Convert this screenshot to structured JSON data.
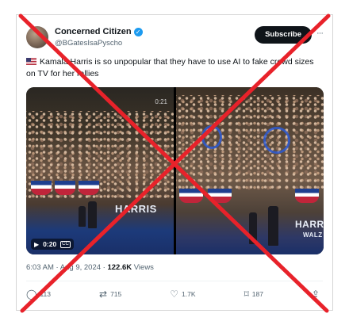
{
  "account": {
    "name": "Concerned Citizen",
    "handle": "@BGatesIsaPyscho",
    "subscribe_label": "Subscribe",
    "more_label": "···"
  },
  "tweet": {
    "text": "Kamala Harris is so unpopular that they have to use AI to fake crowd sizes on TV for her rallies"
  },
  "media": {
    "left": {
      "video_time": "0:20",
      "corner_time": "0:21",
      "cc_label": "CC",
      "sign_text": "HARRIS"
    },
    "right": {
      "sign_text": "HARRIS",
      "sign_sub": "WALZ"
    }
  },
  "meta": {
    "time": "6:03 AM",
    "date": "Aug 9, 2024",
    "views_count": "122.6K",
    "views_label": "Views"
  },
  "actions": {
    "replies": "113",
    "reposts": "715",
    "likes": "1.7K",
    "bookmarks": "187"
  },
  "colors": {
    "verified": "#1d9bf0",
    "subscribe_bg": "#0f1419",
    "x_overlay": "#e8222a"
  },
  "icons": [
    "verified-badge-icon",
    "more-icon",
    "play-icon",
    "cc-icon",
    "reply-icon",
    "repost-icon",
    "like-icon",
    "bookmark-icon",
    "share-icon"
  ]
}
